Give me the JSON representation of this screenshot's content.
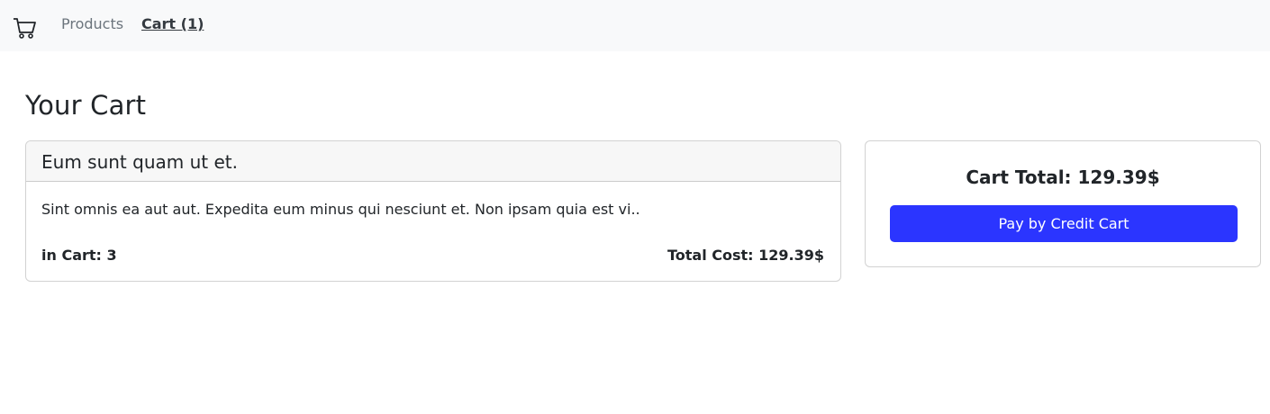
{
  "navbar": {
    "brand_icon": "shopping-cart-icon",
    "links": [
      {
        "label": "Products"
      },
      {
        "label": "Cart (1)"
      }
    ]
  },
  "page": {
    "title": "Your Cart"
  },
  "cart_item": {
    "title": "Eum sunt quam ut et.",
    "description": "Sint omnis ea aut aut. Expedita eum minus qui nesciunt et. Non ipsam quia est vi..",
    "quantity_text": "in Cart: 3",
    "total_text": "Total Cost: 129.39$"
  },
  "summary": {
    "total_text": "Cart Total: 129.39$",
    "pay_label": "Pay by Credit Cart",
    "pay_color": "#2b35ff"
  }
}
